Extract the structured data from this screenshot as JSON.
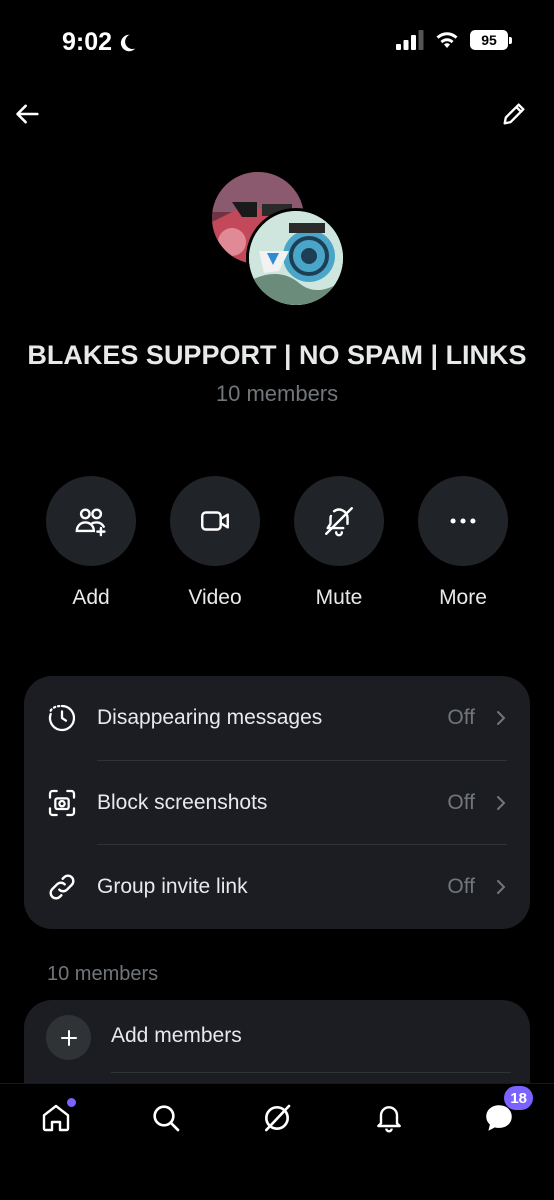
{
  "status_bar": {
    "time": "9:02",
    "battery": "95"
  },
  "group": {
    "name": "BLAKES SUPPORT | NO SPAM | LINKS",
    "members": "10 members"
  },
  "actions": [
    {
      "label": "Add",
      "icon": "add-people-icon"
    },
    {
      "label": "Video",
      "icon": "video-icon"
    },
    {
      "label": "Mute",
      "icon": "bell-off-icon"
    },
    {
      "label": "More",
      "icon": "more-icon"
    }
  ],
  "settings": [
    {
      "label": "Disappearing messages",
      "value": "Off",
      "icon": "timer-icon"
    },
    {
      "label": "Block screenshots",
      "value": "Off",
      "icon": "screenshot-camera-icon"
    },
    {
      "label": "Group invite link",
      "value": "Off",
      "icon": "link-icon"
    }
  ],
  "members_section": {
    "label": "10 members",
    "add_label": "Add members"
  },
  "bottom_nav": {
    "messages_badge": "18"
  },
  "colors": {
    "accent": "#7b63ff",
    "card_bg": "#1c1d22",
    "muted": "#71767b"
  }
}
